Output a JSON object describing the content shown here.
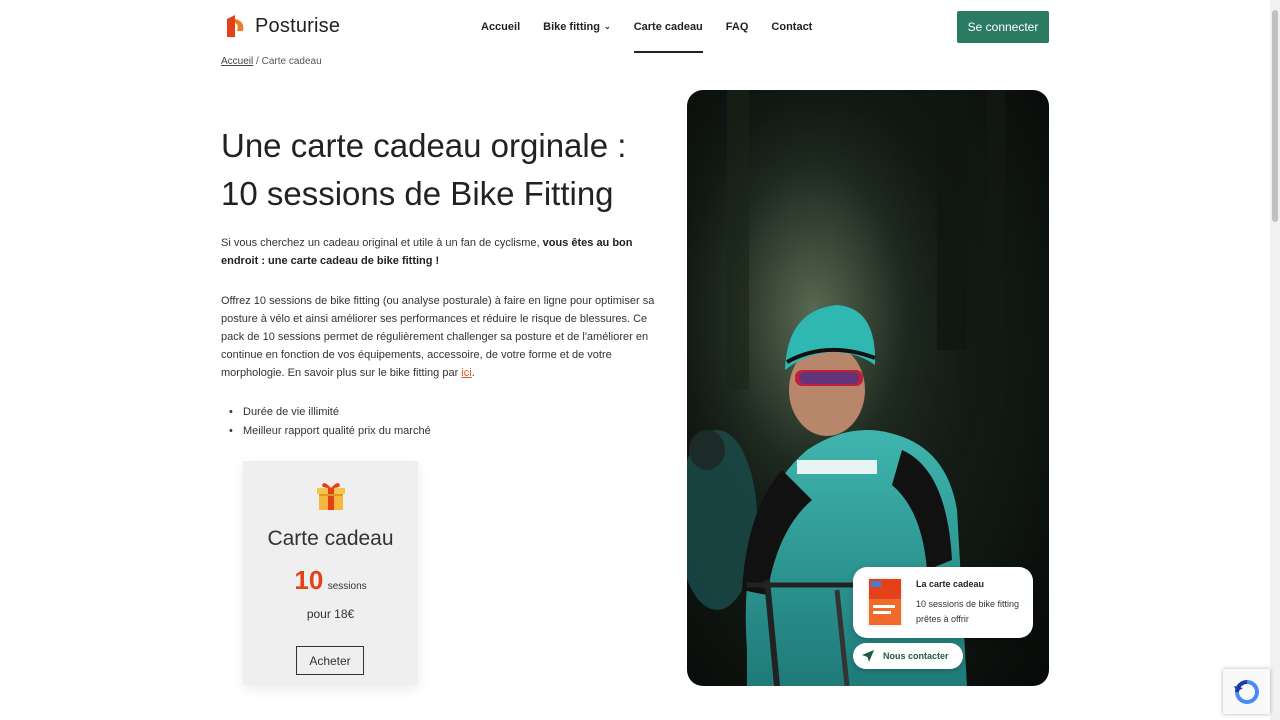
{
  "header": {
    "brand": "Posturise",
    "nav": [
      {
        "label": "Accueil",
        "active": false
      },
      {
        "label": "Bike fitting",
        "active": false,
        "has_dropdown": true
      },
      {
        "label": "Carte cadeau",
        "active": true
      },
      {
        "label": "FAQ",
        "active": false
      },
      {
        "label": "Contact",
        "active": false
      }
    ],
    "login_label": "Se connecter"
  },
  "breadcrumb": {
    "home": "Accueil",
    "separator": " / ",
    "current": "Carte cadeau"
  },
  "main": {
    "title_line1": "Une carte cadeau orginale :",
    "title_line2": "10 sessions de Bike Fitting",
    "intro_text": "Si vous cherchez un cadeau original et utile à un fan de cyclisme, ",
    "intro_bold": "vous êtes au bon endroit : une carte cadeau de bike fitting !",
    "paragraph": "Offrez 10 sessions de bike fitting (ou analyse posturale) à faire en ligne pour optimiser sa posture à vélo et ainsi améliorer ses performances et réduire le risque de blessures. Ce pack de 10 sessions permet de régulièrement challenger sa posture et de l'améliorer en continue en fonction de vos équipements, accessoire, de votre forme et de votre morphologie. En savoir plus sur le bike fitting par ",
    "paragraph_link": "ici",
    "paragraph_end": ".",
    "bullets": [
      "Durée de vie illimité",
      "Meilleur rapport qualité prix du marché"
    ]
  },
  "gift_card": {
    "icon": "gift-icon",
    "title": "Carte cadeau",
    "count": "10",
    "unit": "sessions",
    "price": "pour 18€",
    "buy_label": "Acheter"
  },
  "overlay": {
    "title": "La carte cadeau",
    "description": "10 sessions de bike fitting prêtes à offrir",
    "contact_label": "Nous contacter"
  },
  "colors": {
    "brand_orange": "#e5401a",
    "login_green": "#2b7a62",
    "link_orange": "#e55a1c"
  }
}
